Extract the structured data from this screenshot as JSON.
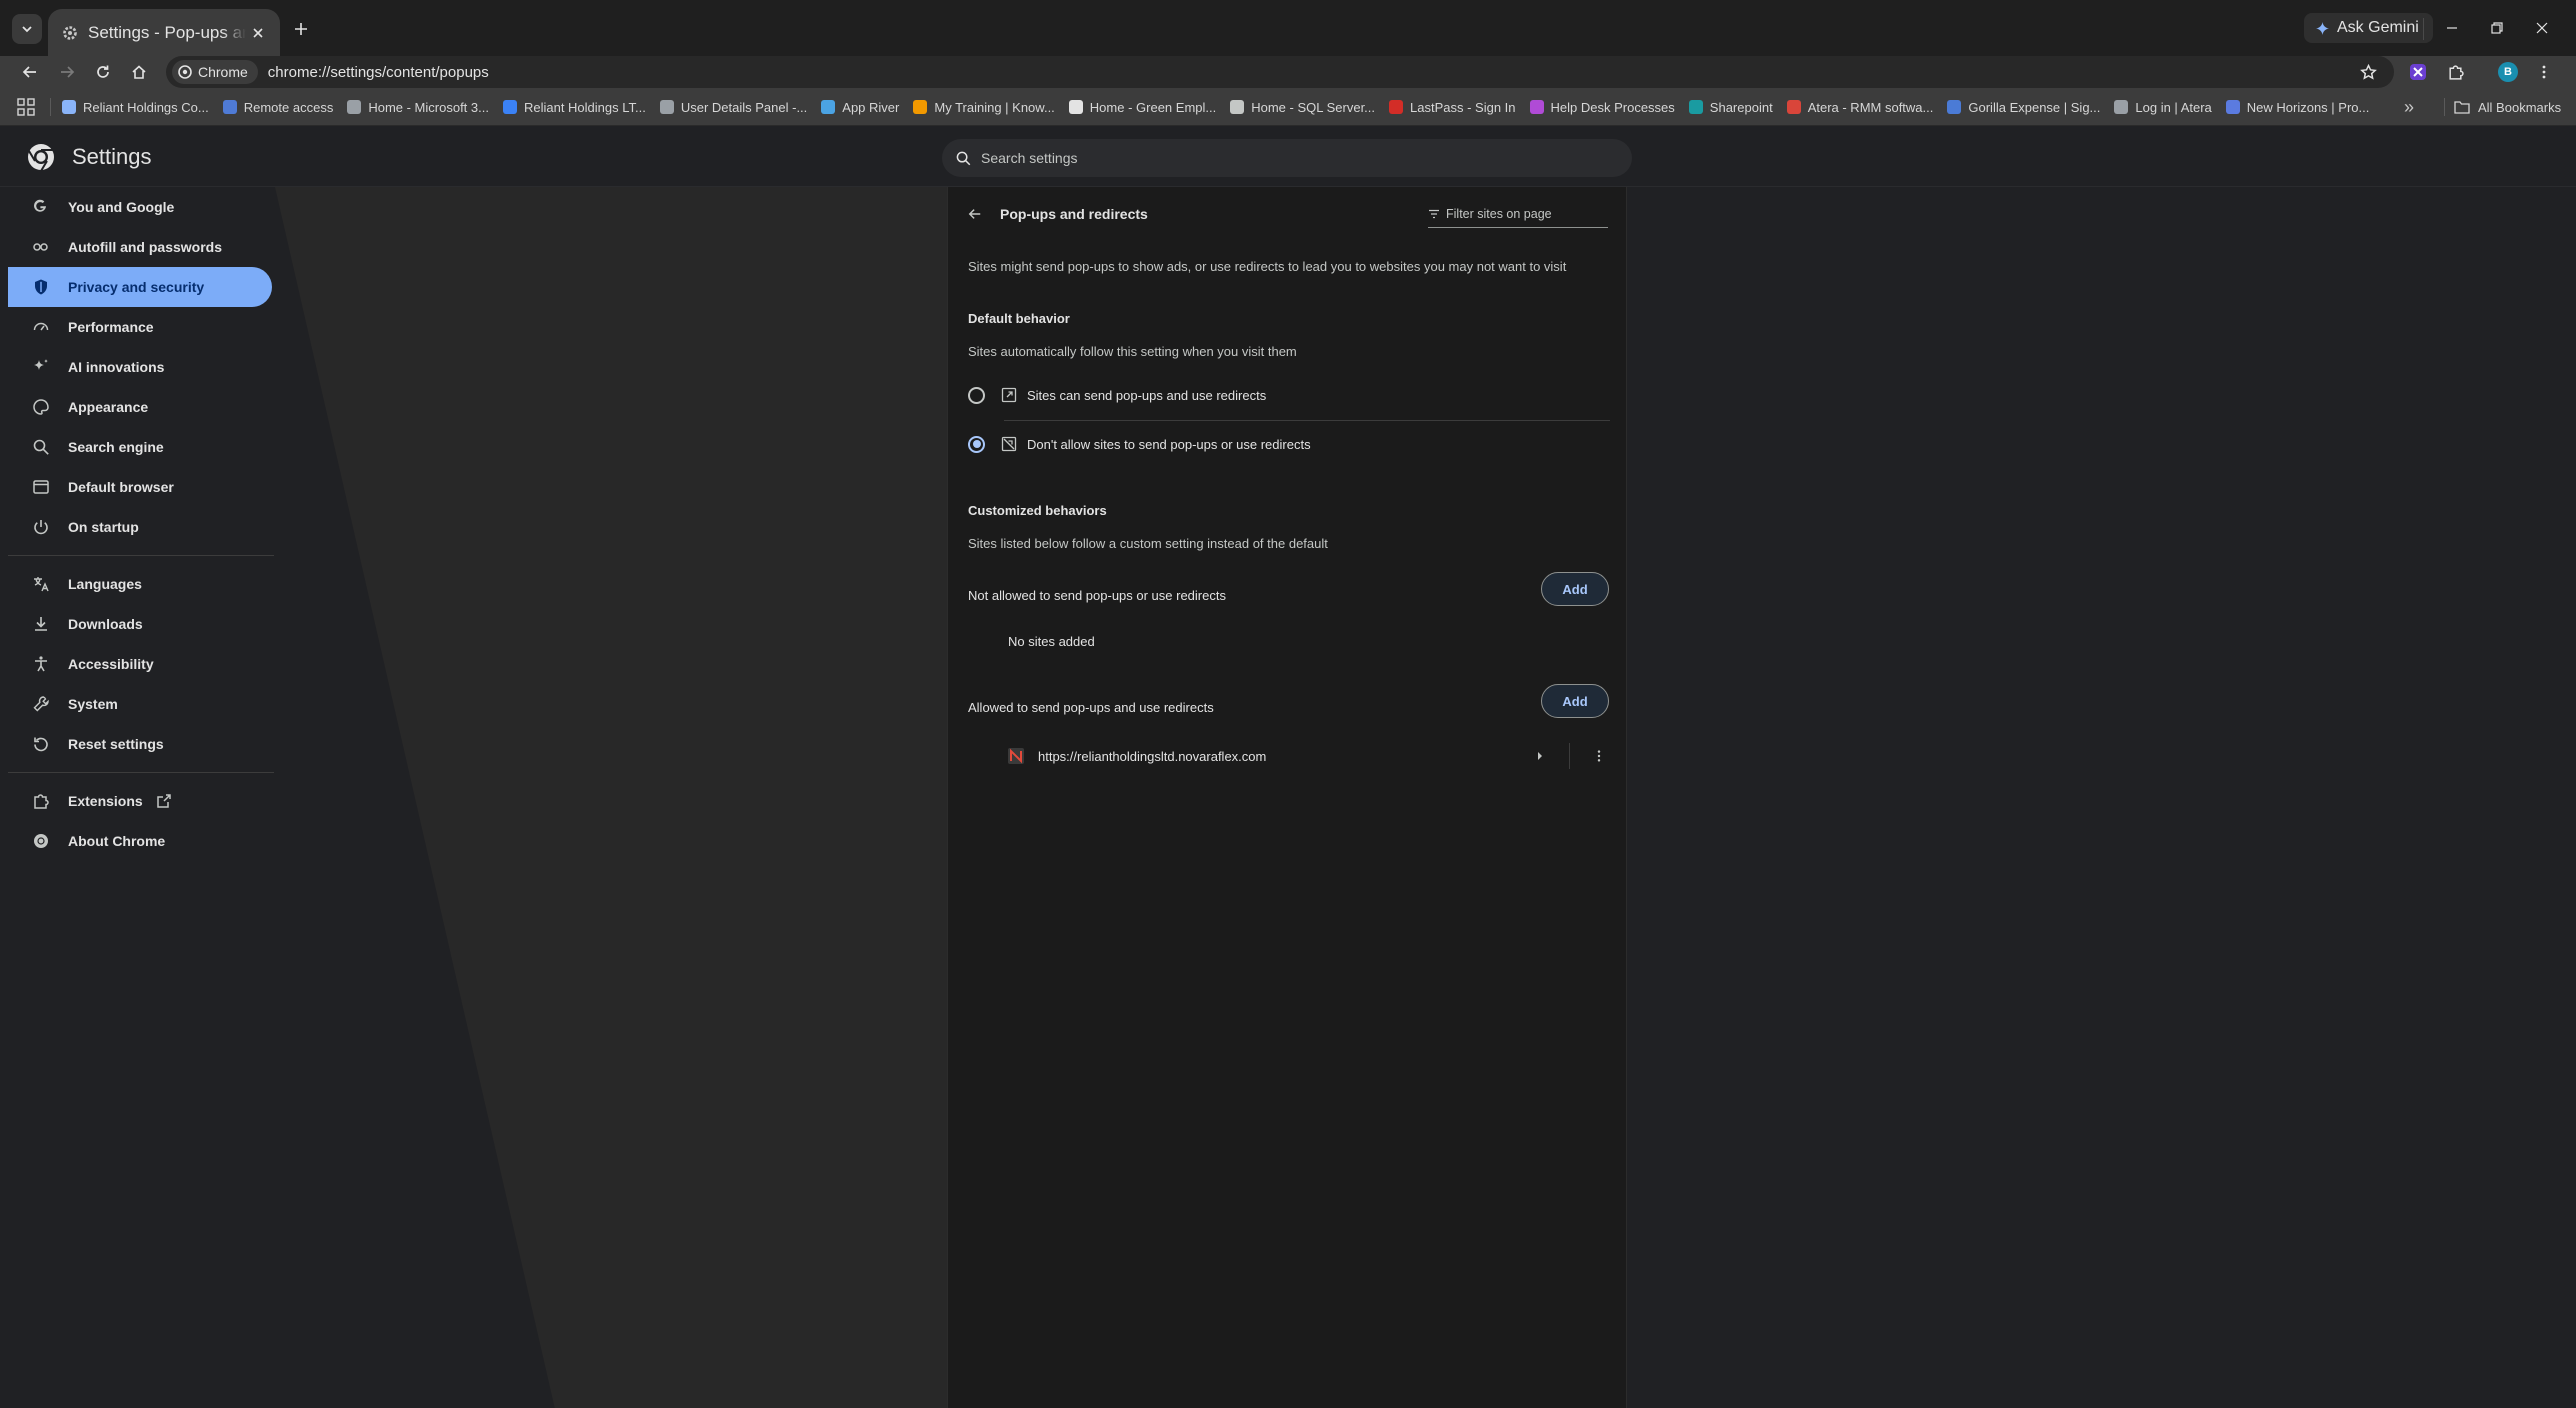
{
  "browser": {
    "tab": {
      "title": "Settings - Pop-ups and redirects"
    },
    "gemini_label": "Ask Gemini",
    "site_chip": "Chrome",
    "url": "chrome://settings/content/popups",
    "profile_initial": "B"
  },
  "bookmarks": {
    "items": [
      {
        "label": "Reliant Holdings Co...",
        "color": "#8ab4f8"
      },
      {
        "label": "Remote access",
        "color": "#4f7bd6"
      },
      {
        "label": "Home - Microsoft 3...",
        "color": "#9aa0a6"
      },
      {
        "label": "Reliant Holdings LT...",
        "color": "#3b82f6"
      },
      {
        "label": "User Details Panel -...",
        "color": "#9aa0a6"
      },
      {
        "label": "App River",
        "color": "#4ba3e3"
      },
      {
        "label": "My Training | Know...",
        "color": "#f29900"
      },
      {
        "label": "Home - Green Empl...",
        "color": "#e3e3e3"
      },
      {
        "label": "Home - SQL Server...",
        "color": "#c4c7c5"
      },
      {
        "label": "LastPass - Sign In",
        "color": "#d32d27"
      },
      {
        "label": "Help Desk Processes",
        "color": "#b04bd6"
      },
      {
        "label": "Sharepoint",
        "color": "#1a9ba1"
      },
      {
        "label": "Atera - RMM softwa...",
        "color": "#d9453a"
      },
      {
        "label": "Gorilla Expense | Sig...",
        "color": "#4b7bd6"
      },
      {
        "label": "Log in | Atera",
        "color": "#9aa0a6"
      },
      {
        "label": "New Horizons | Pro...",
        "color": "#5b7be0"
      }
    ],
    "all_bookmarks": "All Bookmarks"
  },
  "settings": {
    "title": "Settings",
    "search_placeholder": "Search settings",
    "nav": [
      {
        "label": "You and Google",
        "icon": "google-icon"
      },
      {
        "label": "Autofill and passwords",
        "icon": "key-icon"
      },
      {
        "label": "Privacy and security",
        "icon": "shield-icon",
        "active": true
      },
      {
        "label": "Performance",
        "icon": "speedometer-icon"
      },
      {
        "label": "AI innovations",
        "icon": "sparkle-icon"
      },
      {
        "label": "Appearance",
        "icon": "palette-icon"
      },
      {
        "label": "Search engine",
        "icon": "search-icon"
      },
      {
        "label": "Default browser",
        "icon": "browser-icon"
      },
      {
        "label": "On startup",
        "icon": "power-icon"
      },
      {
        "label": "Languages",
        "icon": "translate-icon"
      },
      {
        "label": "Downloads",
        "icon": "download-icon"
      },
      {
        "label": "Accessibility",
        "icon": "accessibility-icon"
      },
      {
        "label": "System",
        "icon": "wrench-icon"
      },
      {
        "label": "Reset settings",
        "icon": "reset-icon"
      },
      {
        "label": "Extensions",
        "icon": "puzzle-icon"
      },
      {
        "label": "About Chrome",
        "icon": "chrome-icon"
      }
    ]
  },
  "page": {
    "title": "Pop-ups and redirects",
    "filter_placeholder": "Filter sites on page",
    "description": "Sites might send pop-ups to show ads, or use redirects to lead you to websites you may not want to visit",
    "default_behavior": {
      "heading": "Default behavior",
      "subheading": "Sites automatically follow this setting when you visit them",
      "options": [
        {
          "label": "Sites can send pop-ups and use redirects",
          "checked": false
        },
        {
          "label": "Don't allow sites to send pop-ups or use redirects",
          "checked": true
        }
      ]
    },
    "customized": {
      "heading": "Customized behaviors",
      "subheading": "Sites listed below follow a custom setting instead of the default",
      "blocked_label": "Not allowed to send pop-ups or use redirects",
      "blocked_empty": "No sites added",
      "allowed_label": "Allowed to send pop-ups and use redirects",
      "add_label": "Add",
      "allowed_sites": [
        {
          "url": "https://reliantholdingsltd.novaraflex.com"
        }
      ]
    }
  }
}
